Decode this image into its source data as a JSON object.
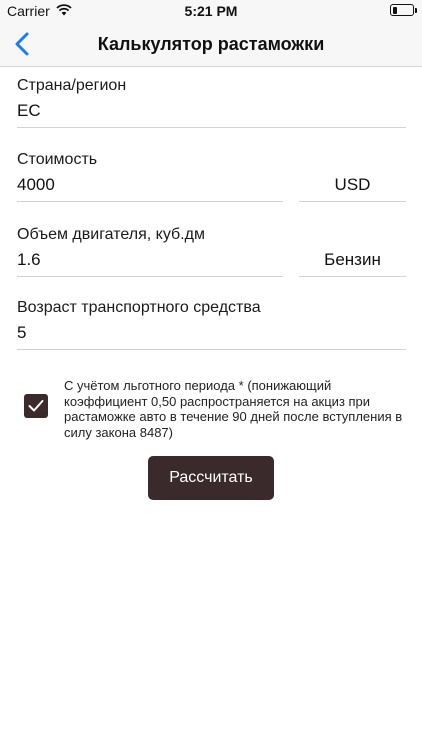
{
  "status_bar": {
    "carrier": "Carrier",
    "time": "5:21 PM",
    "battery_level": 0.25
  },
  "nav": {
    "title": "Калькулятор растаможки",
    "back_icon": "chevron-left-icon",
    "accent_color": "#1a7cf5"
  },
  "form": {
    "region": {
      "label": "Страна/регион",
      "value": "ЕС"
    },
    "cost": {
      "label": "Стоимость",
      "value": "4000",
      "currency": "USD"
    },
    "engine": {
      "label": "Объем двигателя, куб.дм",
      "value": "1.6",
      "fuel": "Бензин"
    },
    "age": {
      "label": "Возраст транспортного средства",
      "value": "5"
    },
    "preferential": {
      "checked": true,
      "text": "С учётом льготного периода * (понижающий коэффициент 0,50 распространяется на акциз при растаможке авто в течение 90 дней после вступления в силу закона 8487)"
    }
  },
  "actions": {
    "calculate_label": "Рассчитать",
    "button_color": "#3a2a2c"
  }
}
